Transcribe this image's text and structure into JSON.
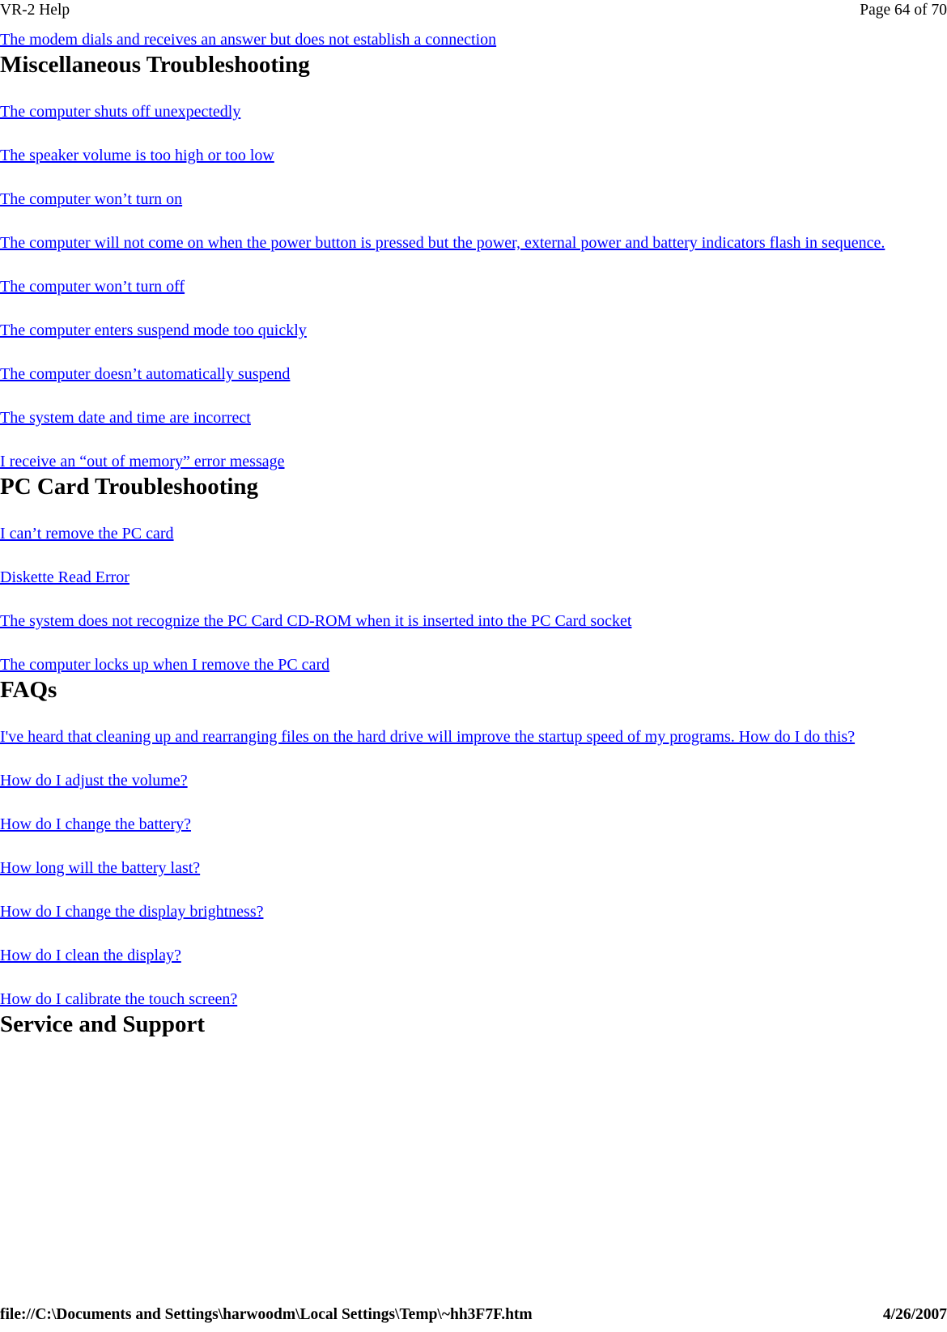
{
  "header": {
    "doc_title": "VR-2 Help",
    "page_indicator": "Page 64 of 70"
  },
  "footer": {
    "file_path": "file://C:\\Documents and Settings\\harwoodm\\Local Settings\\Temp\\~hh3F7F.htm",
    "date": "4/26/2007"
  },
  "colors": {
    "link": "#0000ff",
    "text": "#000000",
    "background": "#ffffff"
  },
  "content": {
    "top_link": "The modem dials and receives an answer but does not establish a connection",
    "sections": [
      {
        "heading": "Miscellaneous Troubleshooting",
        "links": [
          "The computer shuts off unexpectedly",
          "The speaker volume is too high or too low",
          "The computer won’t turn on",
          "The computer will not come on when the power button is pressed but the power, external power and battery indicators flash in sequence.",
          "The computer won’t turn off",
          "The computer enters suspend mode too quickly",
          "The computer doesn’t automatically suspend",
          "The system date and time are incorrect",
          "I receive an “out of memory” error message"
        ]
      },
      {
        "heading": "PC Card Troubleshooting",
        "links": [
          "I can’t remove the PC card",
          "Diskette Read Error",
          "The system does not recognize the PC Card CD-ROM when it is inserted into the PC Card socket",
          "The computer locks up when I remove the PC card"
        ]
      },
      {
        "heading": "FAQs",
        "links": [
          "I've heard that cleaning up and rearranging files on the hard drive will improve the startup speed of my programs. How do I do this?",
          "How do I adjust the volume?",
          "How do I change the battery?",
          "How long will the battery last?",
          "How do I change the display brightness?",
          "How do I clean the display?",
          "How do I calibrate the touch screen?"
        ]
      },
      {
        "heading": "Service and Support",
        "links": []
      }
    ]
  }
}
